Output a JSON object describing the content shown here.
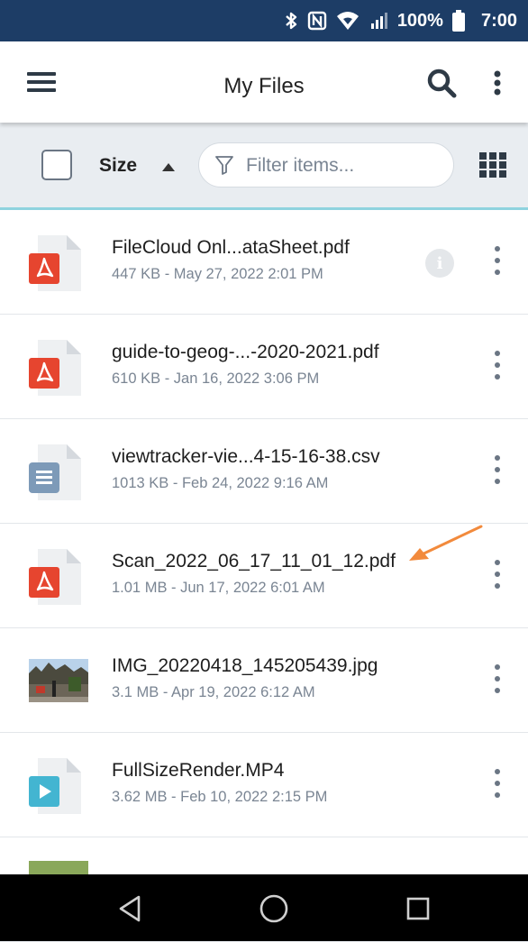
{
  "status_bar": {
    "battery": "100%",
    "time": "7:00",
    "icons": [
      "bluetooth-icon",
      "nfc-icon",
      "wifi-icon",
      "signal-icon",
      "battery-icon"
    ]
  },
  "app_bar": {
    "title": "My Files",
    "icons": [
      "menu-icon",
      "search-icon",
      "more-vert-icon"
    ]
  },
  "toolbar": {
    "sort_label": "Size",
    "sort_direction": "ascending",
    "filter_placeholder": "Filter items...",
    "icons": [
      "filter-icon",
      "grid-view-icon"
    ]
  },
  "files": [
    {
      "name": "FileCloud Onl...ataSheet.pdf",
      "meta": "447 KB - May 27, 2022 2:01 PM",
      "type": "pdf"
    },
    {
      "name": "guide-to-geog-...-2020-2021.pdf",
      "meta": "610 KB - Jan 16, 2022 3:06 PM",
      "type": "pdf"
    },
    {
      "name": "viewtracker-vie...4-15-16-38.csv",
      "meta": "1013 KB - Feb 24, 2022 9:16 AM",
      "type": "csv"
    },
    {
      "name": "Scan_2022_06_17_11_01_12.pdf",
      "meta": "1.01 MB - Jun 17, 2022 6:01 AM",
      "type": "pdf"
    },
    {
      "name": "IMG_20220418_145205439.jpg",
      "meta": "3.1 MB - Apr 19, 2022 6:12 AM",
      "type": "image"
    },
    {
      "name": "FullSizeRender.MP4",
      "meta": "3.62 MB - Feb 10, 2022 2:15 PM",
      "type": "video"
    }
  ],
  "colors": {
    "status_bar": "#1d3d66",
    "pdf_red": "#e6452f",
    "csv_blue": "#7d9ab8",
    "video_teal": "#43b5d1",
    "annotation_arrow": "#f28a3c",
    "toolbar_accent": "#8fd3df"
  }
}
